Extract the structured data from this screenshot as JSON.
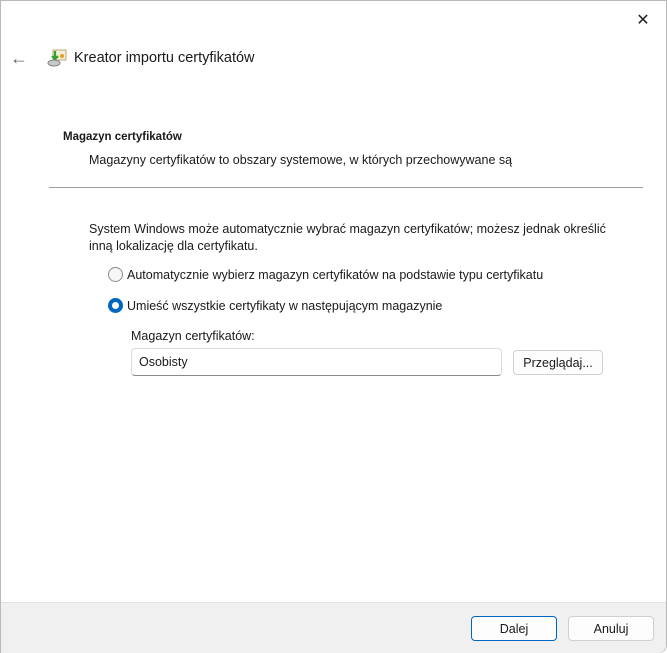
{
  "window": {
    "close_glyph": "✕"
  },
  "header": {
    "back_glyph": "←",
    "title": "Kreator importu certyfikatów"
  },
  "section": {
    "title": "Magazyn certyfikatów",
    "description": "Magazyny certyfikatów to obszary systemowe, w których przechowywane są"
  },
  "intro": "System Windows może automatycznie wybrać magazyn certyfikatów; możesz jednak określić inną lokalizację dla certyfikatu.",
  "options": [
    {
      "label": "Automatycznie wybierz magazyn certyfikatów na podstawie typu certyfikatu",
      "selected": false
    },
    {
      "label": "Umieść wszystkie certyfikaty w następującym magazynie",
      "selected": true
    }
  ],
  "store": {
    "label": "Magazyn certyfikatów:",
    "value": "Osobisty",
    "browse_label": "Przeglądaj..."
  },
  "footer": {
    "next_label": "Dalej",
    "cancel_label": "Anuluj"
  },
  "colors": {
    "accent": "#0067c0",
    "footer_bg": "#f0f0f0"
  }
}
